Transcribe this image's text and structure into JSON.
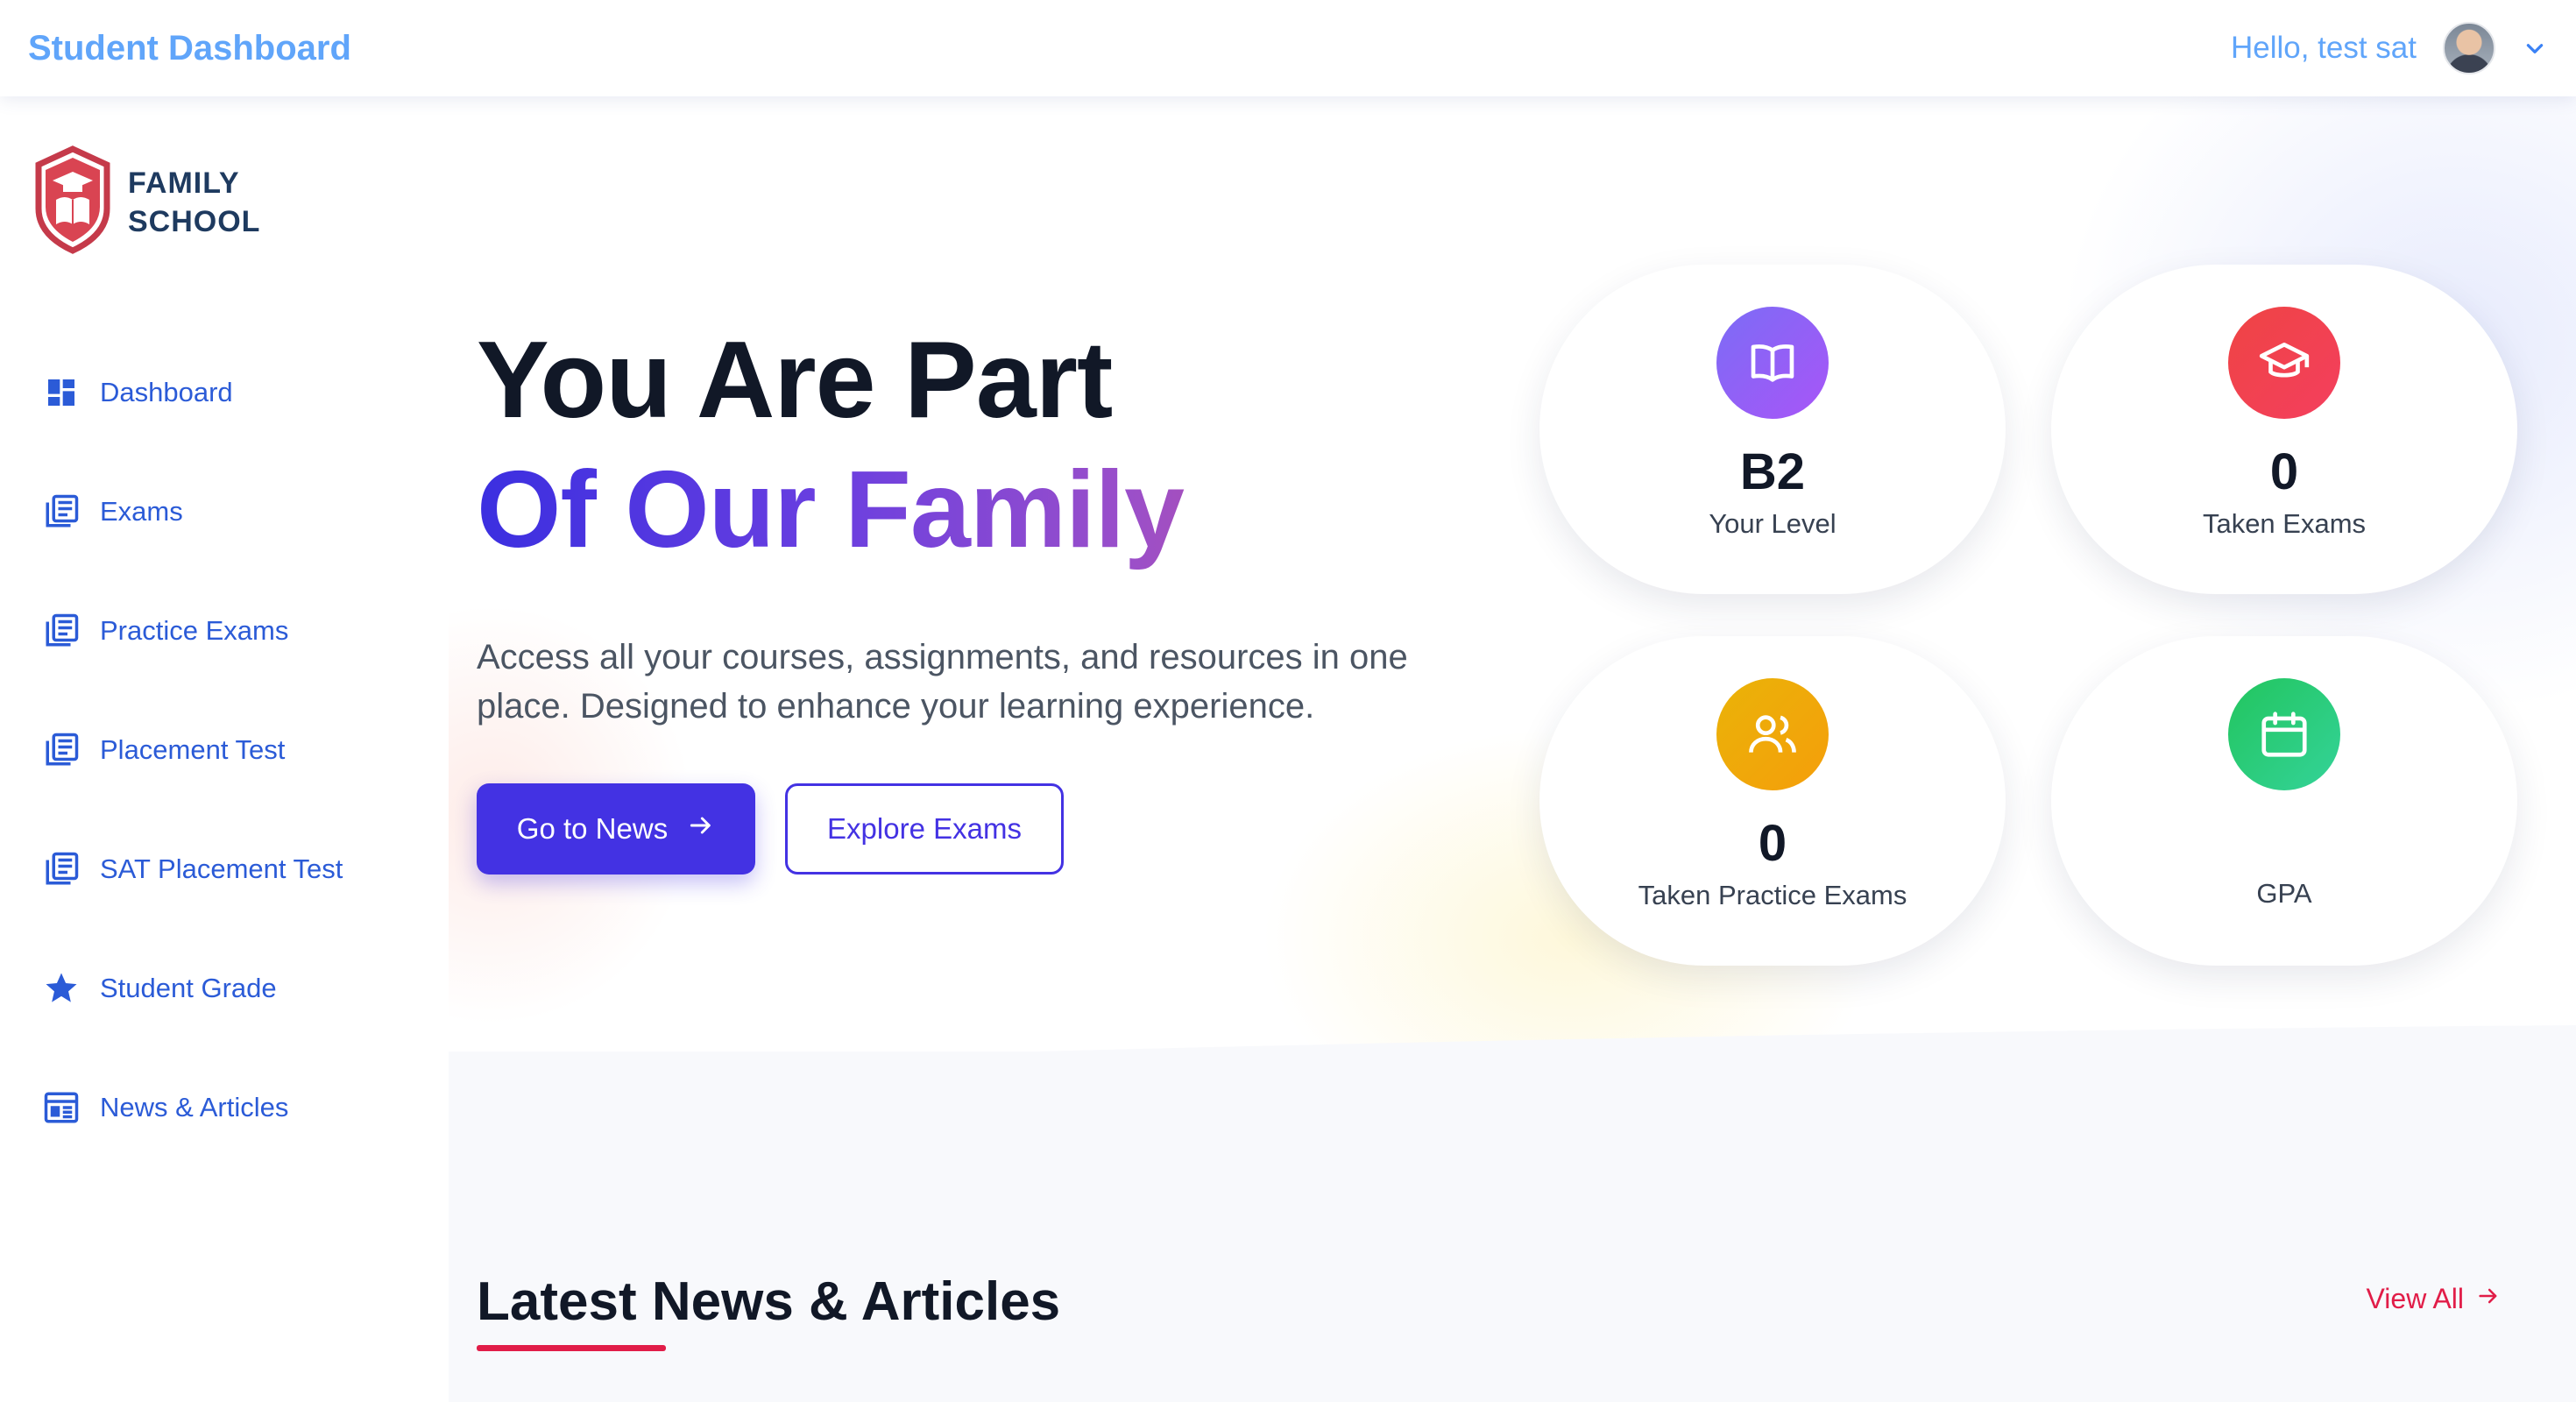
{
  "topbar": {
    "title": "Student Dashboard",
    "greeting": "Hello, test sat"
  },
  "brand": {
    "line1": "FAMILY",
    "line2": "SCHOOL"
  },
  "sidebar": {
    "items": [
      {
        "label": "Dashboard",
        "icon": "dashboard-grid-icon"
      },
      {
        "label": "Exams",
        "icon": "list-document-icon"
      },
      {
        "label": "Practice Exams",
        "icon": "list-document-icon"
      },
      {
        "label": "Placement Test",
        "icon": "list-document-icon"
      },
      {
        "label": "SAT Placement Test",
        "icon": "list-document-icon"
      },
      {
        "label": "Student Grade",
        "icon": "star-icon"
      },
      {
        "label": "News & Articles",
        "icon": "newspaper-icon"
      }
    ]
  },
  "hero": {
    "line1": "You Are Part",
    "line2": "Of Our Family",
    "description": "Access all your courses, assignments, and resources in one place. Designed to enhance your learning experience.",
    "primary_button": "Go to News",
    "secondary_button": "Explore Exams"
  },
  "stats": [
    {
      "value": "B2",
      "label": "Your Level",
      "icon": "book-open-icon",
      "color_from": "#8b5cf6",
      "color_to": "#a855f7"
    },
    {
      "value": "0",
      "label": "Taken Exams",
      "icon": "graduation-cap-icon",
      "color_from": "#ef4444",
      "color_to": "#f43f5e"
    },
    {
      "value": "0",
      "label": "Taken Practice Exams",
      "icon": "users-icon",
      "color_from": "#eab308",
      "color_to": "#f59e0b"
    },
    {
      "value": "",
      "label": "GPA",
      "icon": "calendar-icon",
      "color_from": "#22c55e",
      "color_to": "#34d399"
    }
  ],
  "news": {
    "title": "Latest News & Articles",
    "view_all": "View All"
  },
  "colors": {
    "accent": "#4332e3",
    "link_blue": "#2b5bd7",
    "header_blue": "#60a5fa",
    "news_red": "#e11d48"
  }
}
